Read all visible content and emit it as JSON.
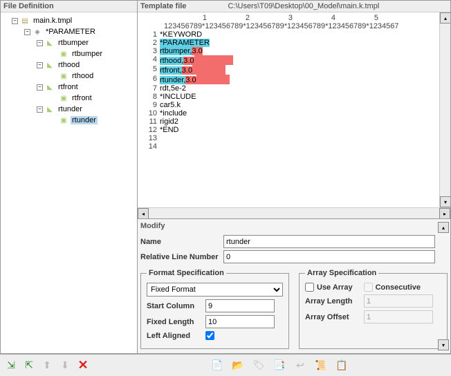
{
  "left_panel": {
    "title": "File Definition",
    "tree": {
      "root": "main.k.tmpl",
      "parameter": "*PARAMETER",
      "groups": [
        {
          "name": "rtbumper",
          "leaf": "rtbumper"
        },
        {
          "name": "rthood",
          "leaf": "rthood"
        },
        {
          "name": "rtfront",
          "leaf": "rtfront"
        },
        {
          "name": "rtunder",
          "leaf": "rtunder"
        }
      ]
    }
  },
  "template": {
    "title": "Template file",
    "path": "C:\\Users\\T09\\Desktop\\00_Model\\main.k.tmpl",
    "col_headers": [
      "1",
      "2",
      "3",
      "4",
      "5"
    ],
    "ruler": "123456789*123456789*123456789*123456789*123456789*1234567",
    "lines": [
      {
        "n": 1,
        "text": "*KEYWORD"
      },
      {
        "n": 2,
        "key": "*PARAMETER"
      },
      {
        "n": 3,
        "key": "rtbumper,",
        "val": "3.0"
      },
      {
        "n": 4,
        "key": "rthood,",
        "val": "3.0",
        "pad": 56
      },
      {
        "n": 5,
        "key": "rtfront,",
        "val": "3.0",
        "pad": 48
      },
      {
        "n": 6,
        "key": "rtunder,",
        "val": "3.0",
        "pad": 48
      },
      {
        "n": 7,
        "text": "rdt,5e-2"
      },
      {
        "n": 8,
        "text": "*INCLUDE"
      },
      {
        "n": 9,
        "text": "car5.k"
      },
      {
        "n": 10,
        "text": "*include"
      },
      {
        "n": 11,
        "text": "rigid2"
      },
      {
        "n": 12,
        "text": "*END"
      },
      {
        "n": 13,
        "text": ""
      },
      {
        "n": 14,
        "text": ""
      }
    ]
  },
  "modify": {
    "title": "Modify",
    "name_label": "Name",
    "name_value": "rtunder",
    "rel_line_label": "Relative Line Number",
    "rel_line_value": "0",
    "format": {
      "legend": "Format Specification",
      "type_label": "Fixed Format",
      "start_col_label": "Start Column",
      "start_col_value": "9",
      "fixed_len_label": "Fixed Length",
      "fixed_len_value": "10",
      "left_align_label": "Left Aligned",
      "left_align_checked": true
    },
    "array": {
      "legend": "Array Specification",
      "use_array_label": "Use Array",
      "use_array_checked": false,
      "consecutive_label": "Consecutive",
      "length_label": "Array Length",
      "length_value": "1",
      "offset_label": "Array Offset",
      "offset_value": "1"
    }
  },
  "toolbar": {
    "left": [
      "tree-expand",
      "tree-collapse",
      "arrow-up",
      "arrow-down",
      "delete"
    ],
    "right": [
      "doc-new",
      "doc-open",
      "tag",
      "copy",
      "send-back",
      "script",
      "script2"
    ]
  }
}
